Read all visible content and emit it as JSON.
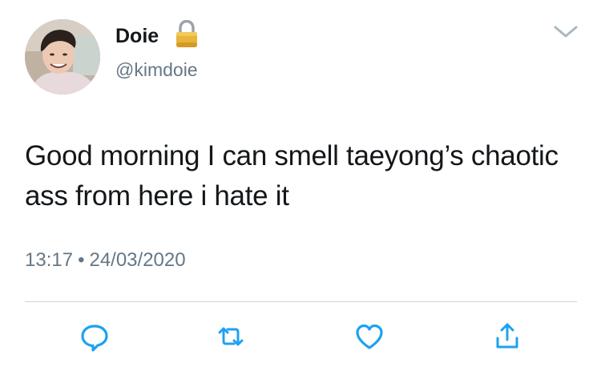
{
  "user": {
    "display_name": "Doie",
    "handle": "@kimdoie",
    "avatar_icon": "avatar",
    "protected_icon": "lock-icon"
  },
  "tweet": {
    "text": "Good morning I can smell taeyong’s chaotic ass from here i hate it",
    "time": "13:17",
    "separator": "•",
    "date": "24/03/2020"
  },
  "actions": {
    "reply_icon": "reply-icon",
    "retweet_icon": "retweet-icon",
    "like_icon": "heart-icon",
    "share_icon": "share-icon",
    "menu_icon": "chevron-down-icon"
  },
  "colors": {
    "text_primary": "#14171a",
    "text_secondary": "#657786",
    "icon_accent": "#1da1f2",
    "divider": "#cfd6dc"
  }
}
